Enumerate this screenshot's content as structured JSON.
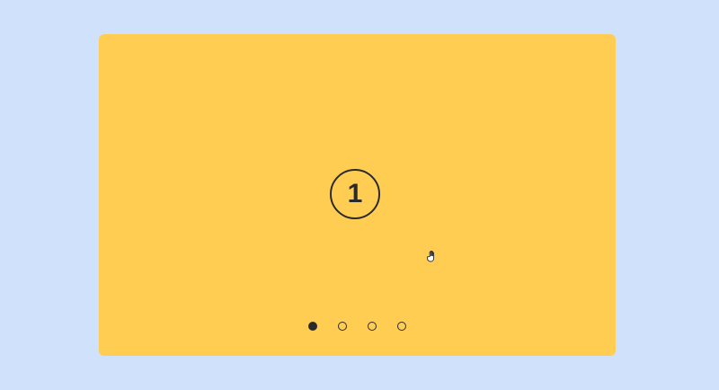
{
  "colors": {
    "page_background": "#cfe1fb",
    "slide_background": "#ffcd52",
    "foreground": "#2b2b2b"
  },
  "carousel": {
    "current_slide": {
      "number": "1"
    },
    "slide_count": 4,
    "active_index": 1,
    "dots": [
      {
        "state": "active"
      },
      {
        "state": "inactive"
      },
      {
        "state": "inactive"
      },
      {
        "state": "inactive"
      }
    ]
  },
  "cursor": {
    "icon": "hand-grab-icon"
  }
}
